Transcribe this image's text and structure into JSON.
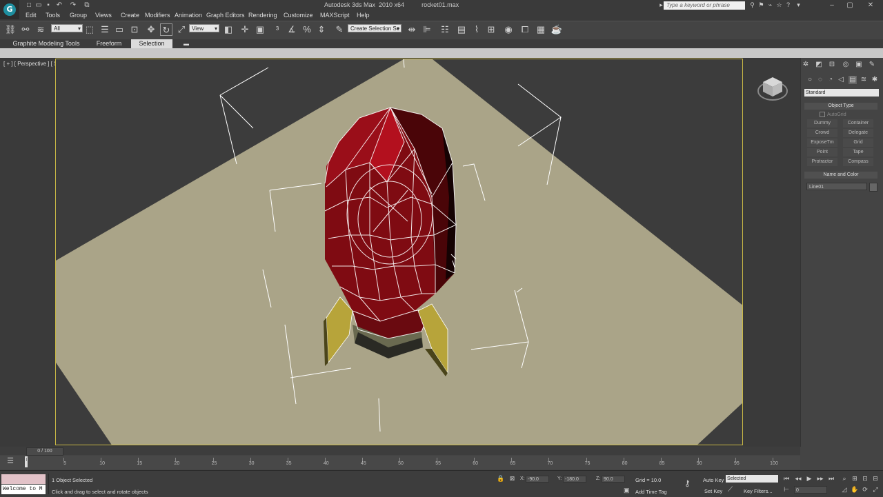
{
  "window": {
    "app_title": "Autodesk 3ds Max  2010 x64",
    "file_name": "rocket01.max",
    "search_placeholder": "Type a keyword or phrase"
  },
  "menu": [
    "Edit",
    "Tools",
    "Group",
    "Views",
    "Create",
    "Modifiers",
    "Animation",
    "Graph Editors",
    "Rendering",
    "Customize",
    "MAXScript",
    "Help"
  ],
  "toolbar": {
    "selection_filter": "All",
    "ref_coord": "View",
    "named_selection": "Create Selection Se"
  },
  "ribbon": {
    "tabs": [
      "Graphite Modeling Tools",
      "Freeform",
      "Selection"
    ],
    "active_tab": "Selection"
  },
  "viewport": {
    "label": "[ + ] [ Perspective ] [ Smooth + Highlights + Edged Faces ]",
    "colors": {
      "ground": "#aaa488",
      "background": "#3c3c3c",
      "rocket_body": "#8a0b12",
      "fins": "#b7a43a",
      "border": "#c9b846"
    }
  },
  "command_panel": {
    "category": "Standard",
    "object_type_header": "Object Type",
    "autogrid": "AutoGrid",
    "buttons": [
      "Dummy",
      "Container",
      "Crowd",
      "Delegate",
      "ExposeTm",
      "Grid",
      "Point",
      "Tape",
      "Protractor",
      "Compass"
    ],
    "name_color_header": "Name and Color",
    "name_value": "Line01"
  },
  "timeline": {
    "frame": "0 / 100",
    "ticks": [
      "0",
      "5",
      "10",
      "15",
      "20",
      "25",
      "30",
      "35",
      "40",
      "45",
      "50",
      "55",
      "60",
      "65",
      "70",
      "75",
      "80",
      "85",
      "90",
      "95",
      "100"
    ]
  },
  "status": {
    "listener": "Welcome to M",
    "selection": "1 Object Selected",
    "prompt": "Click and drag to select and rotate objects",
    "x_label": "X:",
    "x_value": "-90.0",
    "y_label": "Y:",
    "y_value": "-180.0",
    "z_label": "Z:",
    "z_value": "90.0",
    "grid": "Grid = 10.0",
    "auto_key": "Auto Key",
    "selected_dropdown": "Selected",
    "set_key": "Set Key",
    "key_filters": "Key Filters...",
    "add_time_tag": "Add Time Tag",
    "frame_spinner": "0"
  }
}
